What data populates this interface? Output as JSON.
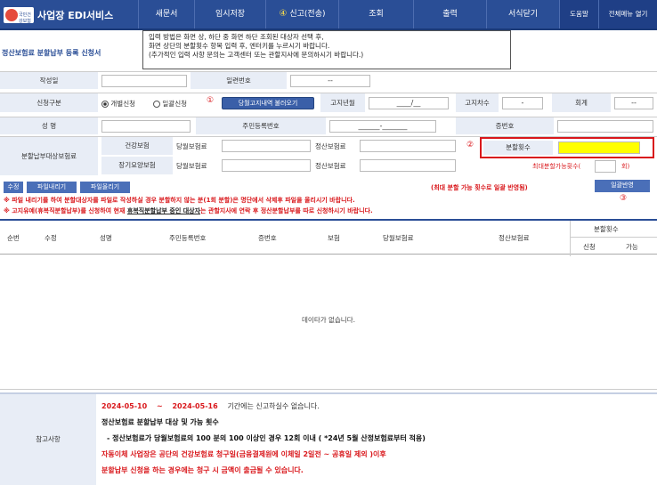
{
  "header": {
    "logo_text": "국민건강보험",
    "app_title": "사업장 EDI서비스",
    "menus": [
      "새문서",
      "임시저장",
      "신고(전송)",
      "조회",
      "출력",
      "서식닫기"
    ],
    "right_menus": [
      "도움말",
      "전체메뉴 열기"
    ],
    "marker4": "④"
  },
  "notice": {
    "line1": "입력 방법은 화면 상, 하단 중 화면 하단 조회된 대상자 선택 후,",
    "line2": "화면 상단의 분할횟수 항목 입력 후, 엔터키를 누르시기 바랍니다.",
    "line3": "(추가적인 입력 사항 문의는 고객센터 또는 관할지사에 문의하시기 바랍니다.)"
  },
  "page_title": "정산보험료 분할납부 등록 신청서",
  "form": {
    "write_date_label": "작성일",
    "serial_label": "일련번호",
    "serial_value": "--",
    "apply_type_label": "신청구분",
    "radio_individual": "개별신청",
    "radio_bulk": "일괄신청",
    "marker1": "①",
    "fetch_button": "당월고지내역 불러오기",
    "notice_ym_label": "고지년월",
    "notice_ym_value": "____/__",
    "notice_seq_label": "고지차수",
    "notice_seq_value": "-",
    "session_label": "회계",
    "session_value": "--",
    "name_label": "성 명",
    "rrn_label": "주민등록번호",
    "rrn_value": "______-_______",
    "cert_label": "증번호",
    "target_label": "분할납부대상보험료",
    "health_label": "건강보험",
    "ltc_label": "장기요양보험",
    "month_ins_label": "당월보험료",
    "settle_ins_label": "정산보험료",
    "marker2": "②",
    "installments_label": "분할횟수",
    "max_label": "최대분할가능횟수(",
    "max_unit": "회)"
  },
  "actions": {
    "edit": "수정",
    "file_down": "파일내리기",
    "file_up": "파일올리기",
    "apply_note": "(최대 분할 가능 횟수로 일괄 반영됨)",
    "bulk_apply": "일괄반영",
    "marker3": "③",
    "warn1": "※ 파일 내리기를 하여 분할대상자를 파일로 작성하실 경우 분할하지 않는 분(1회 분할)은 명단에서 삭제후 파일을 올리시기 바랍니다.",
    "warn2_a": "※ 고지유예(휴복직분할납부)를 신청하여 현재 ",
    "warn2_b": "휴복직분할납부 중인 대상자",
    "warn2_c": "는 관할지사에 연락 후 정산분할납부를 따로 신청하시기 바랍니다."
  },
  "table": {
    "headers": [
      "순번",
      "수정",
      "성명",
      "주민등록번호",
      "증번호",
      "보험",
      "당월보험료",
      "정산보험료"
    ],
    "split_header": "분할횟수",
    "split_sub": [
      "신청",
      "가능"
    ],
    "empty_text": "데이타가 없습니다."
  },
  "reference": {
    "label": "참고사항",
    "period_start": "2024-05-10",
    "period_sep": "~",
    "period_end": "2024-05-16",
    "period_note": "기간에는 신고하실수 없습니다.",
    "line2": "정산보험료 분할납부 대상 및 가능 횟수",
    "line3": "- 정산보험료가 당월보험료의 100 분의 100 이상인 경우 12회 이내 ( *24년 5월 산정보험료부터 적용)",
    "line4": "자동이체 사업장은 공단의 건강보험료 청구일(금융결제원에 이체일 2일전   ~ 공휴일 제외 )이후",
    "line5": "분할납부 신청을 하는 경우에는 청구 시 금액이 출금될 수 있습니다."
  },
  "colors": {
    "header_bg": "#2a4e96",
    "label_bg": "#e8edf6",
    "highlight": "#ffff00",
    "warn": "#d9171b",
    "outline": "#d9171b"
  }
}
